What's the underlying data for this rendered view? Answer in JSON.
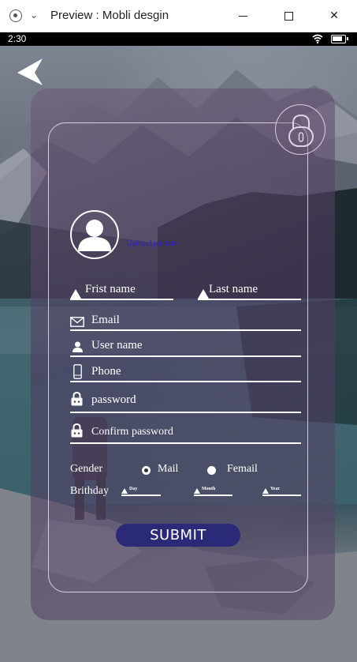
{
  "window": {
    "title": "Preview : Mobli desgin",
    "minimize_icon": "minimize-icon",
    "maximize_icon": "maximize-icon",
    "close_glyph": "✕"
  },
  "status_bar": {
    "time": "2:30"
  },
  "form": {
    "upload_label": "Upload picture",
    "first_name": "Frist name",
    "last_name": "Last name",
    "email": "Email",
    "user_name": "User name",
    "phone": "Phone",
    "password": "password",
    "confirm_password": "Confirm password",
    "gender_label": "Gender",
    "gender_options": [
      {
        "label": "Mail",
        "checked": true
      },
      {
        "label": "Femail",
        "checked": false
      }
    ],
    "birthday_label": "Brithday",
    "birthday_fields": [
      "Day",
      "Month",
      "Year"
    ],
    "submit_label": "SUBMIT"
  },
  "colors": {
    "card_tint": "#6e5876",
    "submit_bg": "#2b2a78",
    "upload_link": "#2a1cd6",
    "text": "#ffffff"
  }
}
